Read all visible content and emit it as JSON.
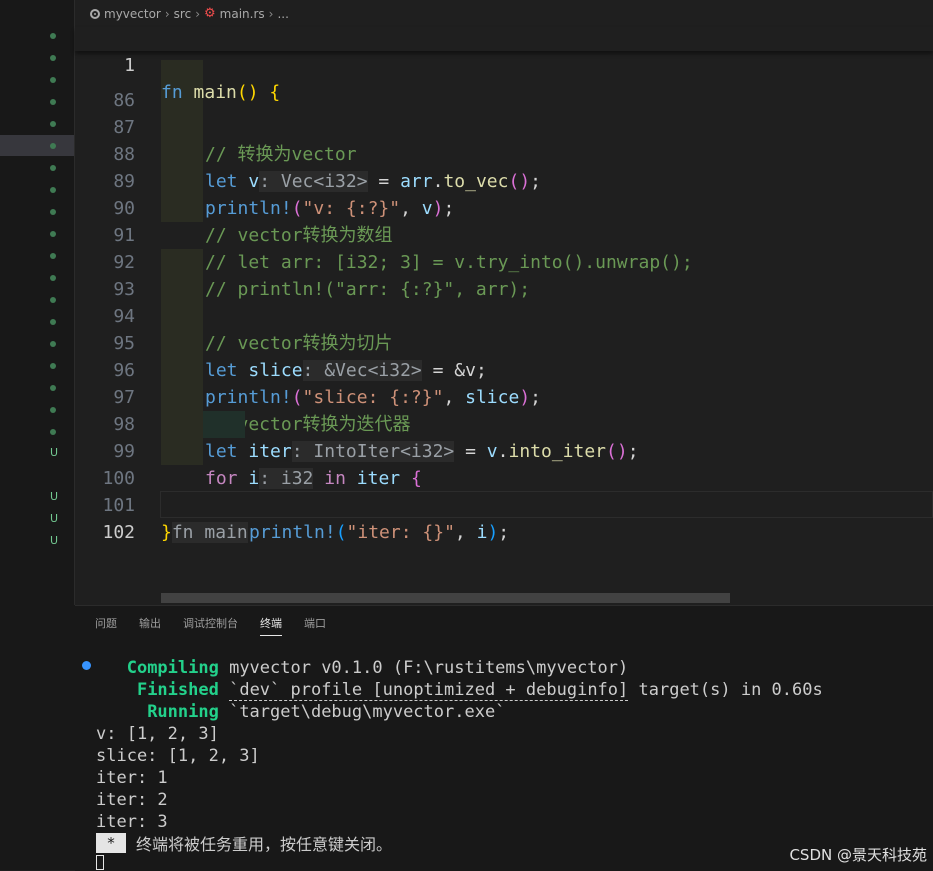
{
  "breadcrumb": {
    "items": [
      "myvector",
      "src",
      "main.rs",
      "..."
    ]
  },
  "sticky": {
    "line_number": "1",
    "code": "fn main() {"
  },
  "code_lines": {
    "l86": {
      "n": "86",
      "comment": "// 转换为vector"
    },
    "l87": {
      "n": "87",
      "kw": "let",
      "var": "v",
      "hint": ": Vec<i32>",
      "eq": " = ",
      "recv": "arr",
      "dot": ".",
      "method": "to_vec",
      "tail": "();"
    },
    "l88": {
      "n": "88",
      "mac": "println!",
      "open": "(",
      "str": "\"v: {:?}\"",
      "mid": ", ",
      "arg": "v",
      "close": ");"
    },
    "l89": {
      "n": "89",
      "comment": "// vector转换为数组"
    },
    "l90": {
      "n": "90",
      "comment": "// let arr: [i32; 3] = v.try_into().unwrap();"
    },
    "l91": {
      "n": "91",
      "comment": "// println!(\"arr: {:?}\", arr);"
    },
    "l92": {
      "n": "92"
    },
    "l93": {
      "n": "93",
      "comment": "// vector转换为切片"
    },
    "l94": {
      "n": "94",
      "kw": "let",
      "var": "slice",
      "hint": ": &Vec<i32>",
      "eq": " = ",
      "rest": "&v;"
    },
    "l95": {
      "n": "95",
      "mac": "println!",
      "open": "(",
      "str": "\"slice: {:?}\"",
      "mid": ", ",
      "arg": "slice",
      "close": ");"
    },
    "l96": {
      "n": "96",
      "comment": "// vector转换为迭代器"
    },
    "l97": {
      "n": "97",
      "kw": "let",
      "var": "iter",
      "hint": ": IntoIter<i32>",
      "eq": " = ",
      "recv": "v",
      "dot": ".",
      "method": "into_iter",
      "tail": "();"
    },
    "l98": {
      "n": "98",
      "kw": "for",
      "var": "i",
      "hint": ": i32",
      "in": "in",
      "iter": "iter",
      "brace": "{"
    },
    "l99": {
      "n": "99",
      "mac": "println!",
      "open": "(",
      "str": "\"iter: {}\"",
      "mid": ", ",
      "arg": "i",
      "close": ");"
    },
    "l100": {
      "n": "100",
      "brace": "}"
    },
    "l101": {
      "n": "101",
      "brace": "}",
      "hint": "fn main"
    },
    "l102": {
      "n": "102"
    }
  },
  "panel": {
    "tabs": [
      "问题",
      "输出",
      "调试控制台",
      "终端",
      "端口"
    ],
    "active_tab": "终端"
  },
  "terminal": {
    "compiling_label": "Compiling",
    "compiling_text": " myvector v0.1.0 (F:\\rustitems\\myvector)",
    "finished_label": "Finished",
    "finished_profile": "`dev` profile [unoptimized + debuginfo]",
    "finished_text": " target(s) in 0.60s",
    "running_label": "Running",
    "running_text": " `target\\debug\\myvector.exe`",
    "output": [
      "v: [1, 2, 3]",
      "slice: [1, 2, 3]",
      "iter: 1",
      "iter: 2",
      "iter: 3"
    ],
    "notice_star": "*",
    "notice": "终端将被任务重用，按任意键关闭。"
  },
  "watermark": "CSDN @景天科技苑",
  "git_markers": {
    "untracked": "U"
  }
}
